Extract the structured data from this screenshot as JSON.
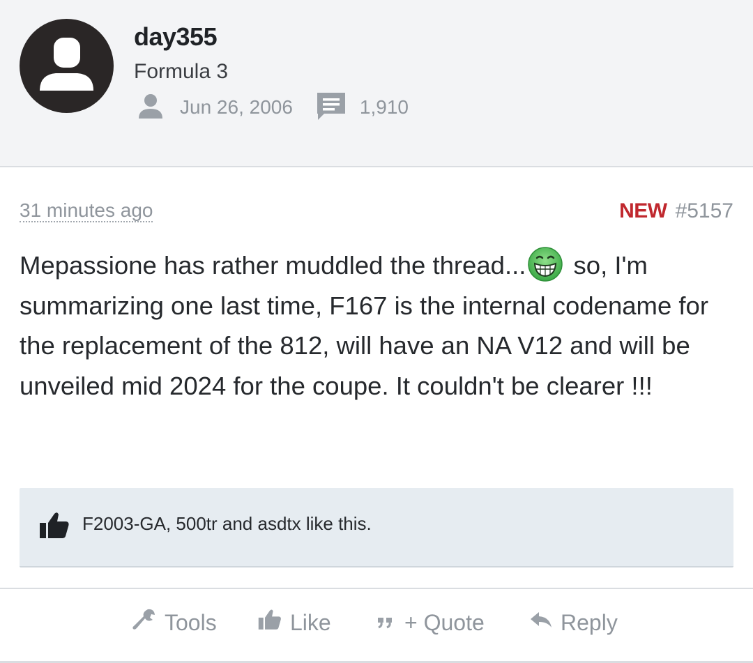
{
  "user": {
    "name": "day355",
    "title": "Formula 3",
    "joined": "Jun 26, 2006",
    "messages": "1,910",
    "avatar_icon": "default-avatar-icon"
  },
  "post": {
    "time": "31 minutes ago",
    "new_label": "NEW",
    "number": "#5157",
    "text_part1": "Mepassione has rather muddled the thread...",
    "emoji": "grinning-face-emoji",
    "text_part2": " so, I'm summarizing one last time, F167 is the internal codename for the replacement of the 812, will have an NA V12 and will be unveiled mid 2024 for the coupe. It couldn't be clearer !!!"
  },
  "likes": {
    "text": "F2003-GA, 500tr and asdtx like this.",
    "icon": "thumbs-up-icon"
  },
  "actions": {
    "tools": "Tools",
    "like": "Like",
    "quote": "+ Quote",
    "reply": "Reply"
  },
  "colors": {
    "new_badge": "#c0282e",
    "muted": "#8f959c",
    "header_bg": "#f3f4f6",
    "likes_bg": "#e6ecf1"
  }
}
